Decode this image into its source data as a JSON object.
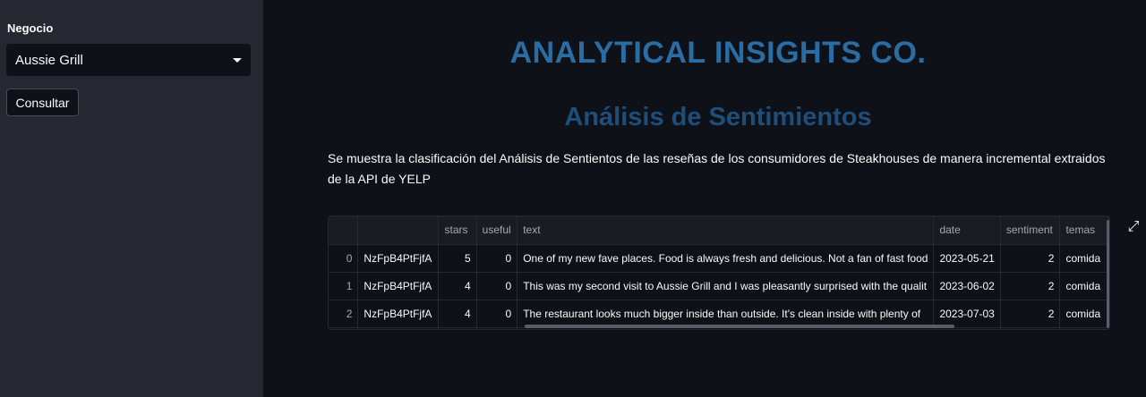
{
  "sidebar": {
    "label": "Negocio",
    "select_value": "Aussie Grill",
    "button_label": "Consultar"
  },
  "main": {
    "title": "ANALYTICAL INSIGHTS CO.",
    "subtitle": "Análisis de Sentimientos",
    "description": "Se muestra la clasificación del Análisis de Sentientos de las reseñas de los consumidores de Steakhouses de manera incremental extraidos de la API de YELP"
  },
  "table": {
    "columns": [
      "",
      "",
      "stars",
      "useful",
      "text",
      "date",
      "sentiment",
      "temas"
    ],
    "rows": [
      {
        "index": "0",
        "id": "NzFpB4PtFjfA",
        "stars": "5",
        "useful": "0",
        "text": "One of my new fave places. Food is always fresh and delicious.   Not a fan of fast food",
        "date": "2023-05-21",
        "sentiment": "2",
        "temas": "comida"
      },
      {
        "index": "1",
        "id": "NzFpB4PtFjfA",
        "stars": "4",
        "useful": "0",
        "text": "This was my second visit to Aussie Grill and I was pleasantly surprised with the qualit",
        "date": "2023-06-02",
        "sentiment": "2",
        "temas": "comida"
      },
      {
        "index": "2",
        "id": "NzFpB4PtFjfA",
        "stars": "4",
        "useful": "0",
        "text": "The restaurant looks much bigger inside than outside. It's clean inside with plenty of",
        "date": "2023-07-03",
        "sentiment": "2",
        "temas": "comida"
      }
    ]
  },
  "colors": {
    "title": "#2b6ca3",
    "subtitle": "#1f4e7a"
  },
  "icons": {
    "select_caret": "chevron-down-icon",
    "expand": "fullscreen-expand-icon"
  }
}
